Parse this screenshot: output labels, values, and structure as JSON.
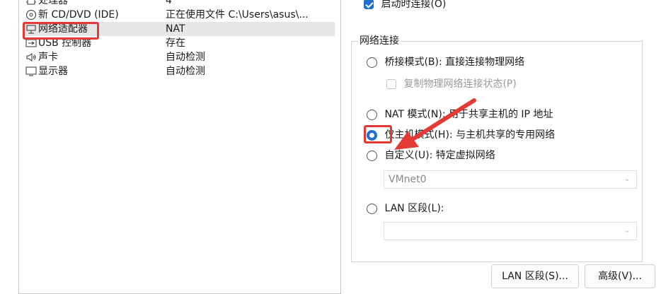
{
  "devices": [
    {
      "name": "处理器",
      "summary": "4",
      "icon": "cpu-icon"
    },
    {
      "name": "新 CD/DVD (IDE)",
      "summary": "正在使用文件 C:\\Users\\asus\\...",
      "icon": "disc-icon"
    },
    {
      "name": "网络适配器",
      "summary": "NAT",
      "icon": "network-adapter-icon",
      "selected": true
    },
    {
      "name": "USB 控制器",
      "summary": "存在",
      "icon": "usb-icon"
    },
    {
      "name": "声卡",
      "summary": "自动检测",
      "icon": "speaker-icon"
    },
    {
      "name": "显示器",
      "summary": "自动检测",
      "icon": "monitor-icon"
    }
  ],
  "device_status": {
    "connect_at_power_on": "启动时连接(O)"
  },
  "network_connection": {
    "legend": "网络连接",
    "bridged": "桥接模式(B): 直接连接物理网络",
    "replicate_state": "复制物理网络连接状态(P)",
    "nat": "NAT 模式(N): 用于共享主机的 IP 地址",
    "host_only": "仅主机模式(H): 与主机共享的专用网络",
    "custom": "自定义(U): 特定虚拟网络",
    "custom_select_value": "VMnet0",
    "lan_segment": "LAN 区段(L):",
    "lan_select_value": ""
  },
  "buttons": {
    "lan_segments": "LAN 区段(S)...",
    "advanced": "高级(V)..."
  },
  "colors": {
    "accent": "#1f6fd1",
    "annotation": "#e53935"
  }
}
